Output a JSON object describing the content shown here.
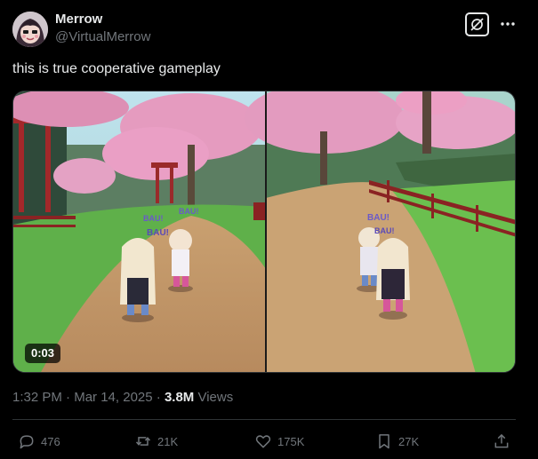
{
  "author": {
    "display_name": "Merrow",
    "handle": "@VirtualMerrow",
    "avatar_icon": "anime-avatar"
  },
  "header_icons": {
    "grok": "grok-icon",
    "more": "more-icon"
  },
  "post": {
    "text": "this is true cooperative gameplay"
  },
  "media": {
    "type": "video",
    "duration": "0:03",
    "overlay_labels": {
      "left": [
        "BAU!",
        "BAU!",
        "BAU!"
      ],
      "right": [
        "BAU!",
        "BAU!"
      ]
    }
  },
  "meta": {
    "time": "1:32 PM",
    "separator": "·",
    "date": "Mar 14, 2025",
    "views_count": "3.8M",
    "views_label": "Views"
  },
  "actions": {
    "replies": "476",
    "reposts": "21K",
    "likes": "175K",
    "bookmarks": "27K"
  },
  "colors": {
    "background": "#000000",
    "text_primary": "#e7e9ea",
    "text_secondary": "#71767b",
    "divider": "#2f3336"
  }
}
